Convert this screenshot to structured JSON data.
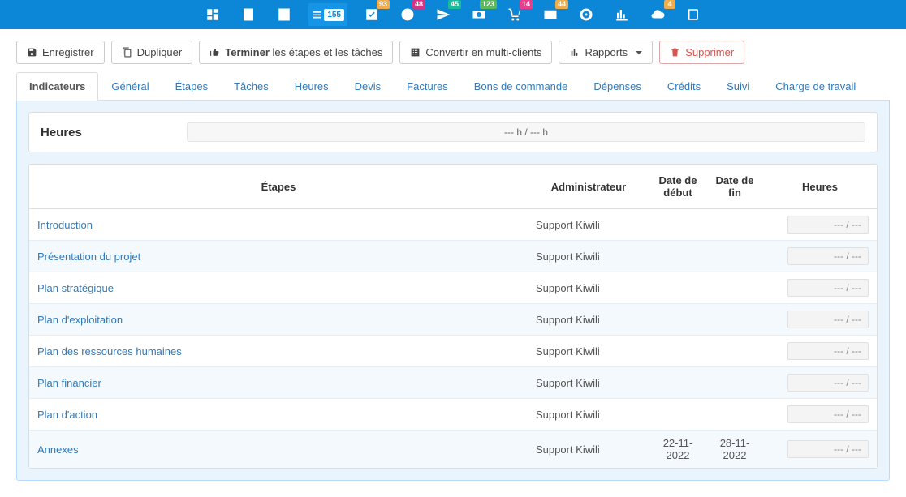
{
  "navbar": {
    "items": [
      {
        "name": "dashboard-icon",
        "badge": null
      },
      {
        "name": "building-icon",
        "badge": null
      },
      {
        "name": "building2-icon",
        "badge": null
      },
      {
        "name": "list-icon",
        "badge": "155",
        "badge_class": "badge-blue",
        "active": true
      },
      {
        "name": "check-icon",
        "badge": "93",
        "badge_class": "badge-orange"
      },
      {
        "name": "clock-icon",
        "badge": "48",
        "badge_class": "badge-magenta"
      },
      {
        "name": "send-icon",
        "badge": "45",
        "badge_class": "badge-teal"
      },
      {
        "name": "money-icon",
        "badge": "123",
        "badge_class": "badge-green"
      },
      {
        "name": "cart-icon",
        "badge": "14",
        "badge_class": "badge-pink"
      },
      {
        "name": "card-icon",
        "badge": "44",
        "badge_class": "badge-yellow"
      },
      {
        "name": "target-icon",
        "badge": null
      },
      {
        "name": "chart-icon",
        "badge": null
      },
      {
        "name": "cloud-icon",
        "badge": "4",
        "badge_class": "badge-orange"
      },
      {
        "name": "book-icon",
        "badge": null
      }
    ]
  },
  "toolbar": {
    "save": "Enregistrer",
    "duplicate": "Dupliquer",
    "finish_strong": "Terminer",
    "finish_rest": " les étapes et les tâches",
    "convert": "Convertir en multi-clients",
    "reports": "Rapports",
    "delete": "Supprimer"
  },
  "tabs": [
    {
      "label": "Indicateurs",
      "active": true
    },
    {
      "label": "Général"
    },
    {
      "label": "Étapes"
    },
    {
      "label": "Tâches"
    },
    {
      "label": "Heures"
    },
    {
      "label": "Devis"
    },
    {
      "label": "Factures"
    },
    {
      "label": "Bons de commande"
    },
    {
      "label": "Dépenses"
    },
    {
      "label": "Crédits"
    },
    {
      "label": "Suivi"
    },
    {
      "label": "Charge de travail"
    }
  ],
  "hours_summary": {
    "title": "Heures",
    "bar_text": "--- h / --- h"
  },
  "table": {
    "headers": {
      "etapes": "Étapes",
      "admin": "Administrateur",
      "date_debut": "Date de début",
      "date_fin": "Date de fin",
      "heures": "Heures"
    },
    "rows": [
      {
        "etape": "Introduction",
        "admin": "Support Kiwili",
        "date_debut": "",
        "date_fin": "",
        "heures": "--- / ---"
      },
      {
        "etape": "Présentation du projet",
        "admin": "Support Kiwili",
        "date_debut": "",
        "date_fin": "",
        "heures": "--- / ---"
      },
      {
        "etape": "Plan stratégique",
        "admin": "Support Kiwili",
        "date_debut": "",
        "date_fin": "",
        "heures": "--- / ---"
      },
      {
        "etape": "Plan d'exploitation",
        "admin": "Support Kiwili",
        "date_debut": "",
        "date_fin": "",
        "heures": "--- / ---"
      },
      {
        "etape": "Plan des ressources humaines",
        "admin": "Support Kiwili",
        "date_debut": "",
        "date_fin": "",
        "heures": "--- / ---"
      },
      {
        "etape": "Plan financier",
        "admin": "Support Kiwili",
        "date_debut": "",
        "date_fin": "",
        "heures": "--- / ---"
      },
      {
        "etape": "Plan d'action",
        "admin": "Support Kiwili",
        "date_debut": "",
        "date_fin": "",
        "heures": "--- / ---"
      },
      {
        "etape": "Annexes",
        "admin": "Support Kiwili",
        "date_debut": "22-11-2022",
        "date_fin": "28-11-2022",
        "heures": "--- / ---"
      }
    ]
  }
}
